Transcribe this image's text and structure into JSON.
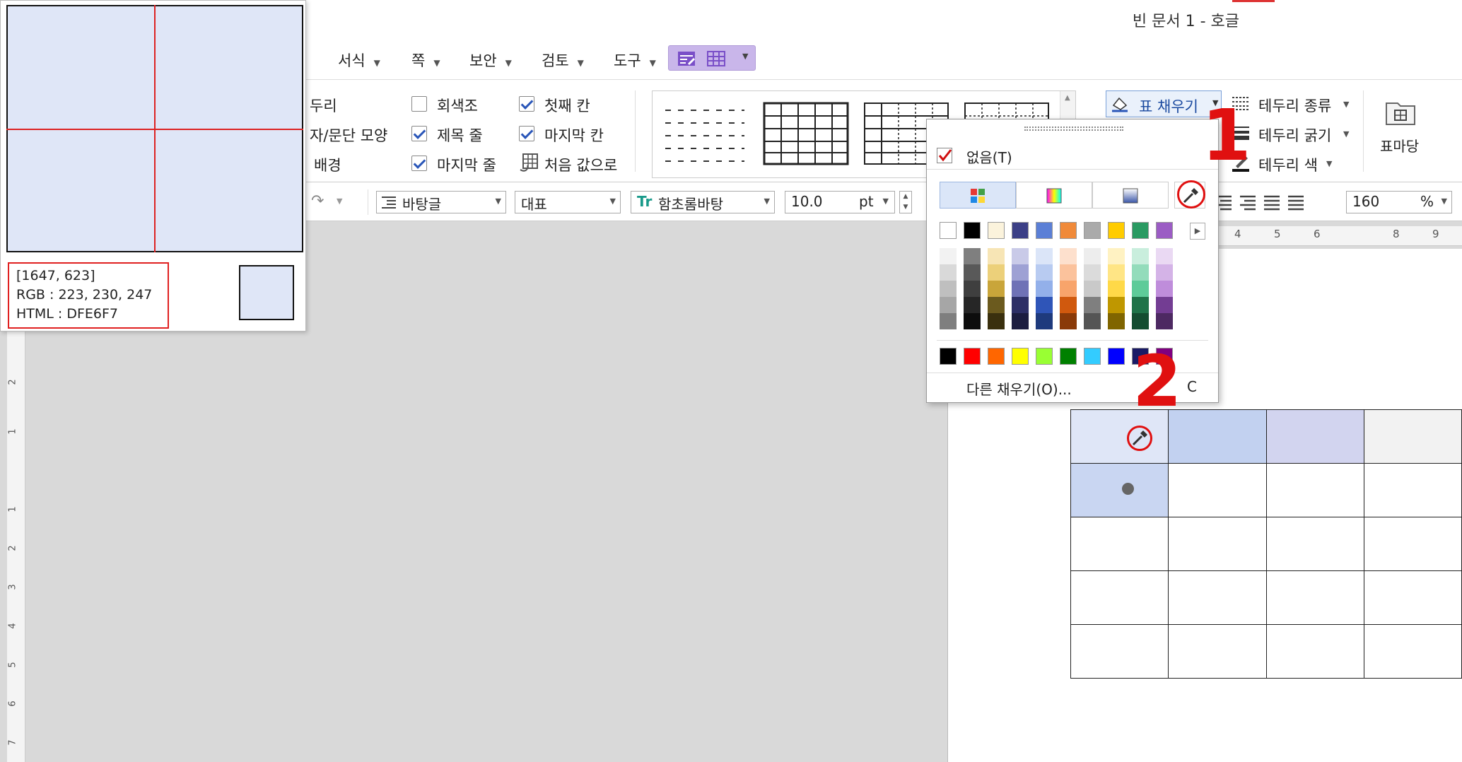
{
  "title": "빈 문서 1 - 호글",
  "menu": [
    {
      "label": "서식"
    },
    {
      "label": "쪽"
    },
    {
      "label": "보안"
    },
    {
      "label": "검토"
    },
    {
      "label": "도구"
    }
  ],
  "ribbon": {
    "left_labels": [
      "두리",
      "자/문단 모양",
      "배경"
    ],
    "checkboxes": [
      {
        "label": "회색조",
        "checked": false
      },
      {
        "label": "제목 줄",
        "checked": true
      },
      {
        "label": "마지막 줄",
        "checked": true
      },
      {
        "label": "첫째 칸",
        "checked": true
      },
      {
        "label": "마지막 칸",
        "checked": true
      }
    ],
    "reset_label": "처음 값으로",
    "fill_button": "표 채우기",
    "border_type": "테두리 종류",
    "border_width": "테두리 굵기",
    "border_color": "테두리 색",
    "table_shortcut": "표마당"
  },
  "toolbar2": {
    "style": "바탕글",
    "lang": "대표",
    "font": "함초롬바탕",
    "size": "10.0",
    "unit": "pt",
    "zoom": "160",
    "zoom_unit": "%"
  },
  "hruler": [
    "4",
    "5",
    "6",
    "8",
    "9"
  ],
  "vruler": [
    "2",
    "1",
    "1",
    "2",
    "3",
    "4",
    "5",
    "6",
    "7"
  ],
  "magnifier": {
    "coords": "[1647, 623]",
    "rgb": "RGB : 223, 230, 247",
    "html": "HTML : DFE6F7",
    "color": "#dfe6f7"
  },
  "popup": {
    "none_label": "없음(T)",
    "more_label": "다른 채우기(O)...",
    "more_shortcut": "C",
    "top_row": [
      "#ffffff",
      "#000000",
      "#fbf3dc",
      "#3b3f86",
      "#5b7fd6",
      "#f08a3a",
      "#aaaaaa",
      "#ffcc00",
      "#2a9a62",
      "#9b5cc4"
    ],
    "shades": [
      [
        "#f2f2f2",
        "#d9d9d9",
        "#bfbfbf",
        "#a6a6a6",
        "#7f7f7f"
      ],
      [
        "#7f7f7f",
        "#595959",
        "#3f3f3f",
        "#262626",
        "#0d0d0d"
      ],
      [
        "#f7e5b5",
        "#ecd07a",
        "#c9a53a",
        "#6b5a1e",
        "#3a300e"
      ],
      [
        "#c9cae8",
        "#9ea1d4",
        "#6f72b6",
        "#2d2f66",
        "#1c1d40"
      ],
      [
        "#dbe5f8",
        "#b8cbf1",
        "#93b0ea",
        "#2f55b8",
        "#1e3a7d"
      ],
      [
        "#fde0cd",
        "#fbc29c",
        "#f8a46b",
        "#d0590e",
        "#8a3a08"
      ],
      [
        "#ededed",
        "#dbdbdb",
        "#c9c9c9",
        "#7f7f7f",
        "#555555"
      ],
      [
        "#fff2c2",
        "#ffe585",
        "#ffd948",
        "#bf9700",
        "#806500"
      ],
      [
        "#c9eedd",
        "#93dcbb",
        "#5ecb99",
        "#1f7349",
        "#144d31"
      ],
      [
        "#ead9f3",
        "#d4b3e7",
        "#bf8ddb",
        "#733d93",
        "#4d2962"
      ]
    ],
    "standard": [
      "#000000",
      "#ff0000",
      "#ff6600",
      "#ffff00",
      "#99ff33",
      "#008000",
      "#33ccff",
      "#0000ff",
      "#1a1a66",
      "#800080"
    ]
  },
  "annotations": {
    "one": "1",
    "two": "2"
  },
  "table_colors": {
    "header1": "#dfe6f7",
    "header2": "#c2d1f0",
    "header3": "#d2d4ef",
    "row2col1": "#c9d6f2"
  }
}
